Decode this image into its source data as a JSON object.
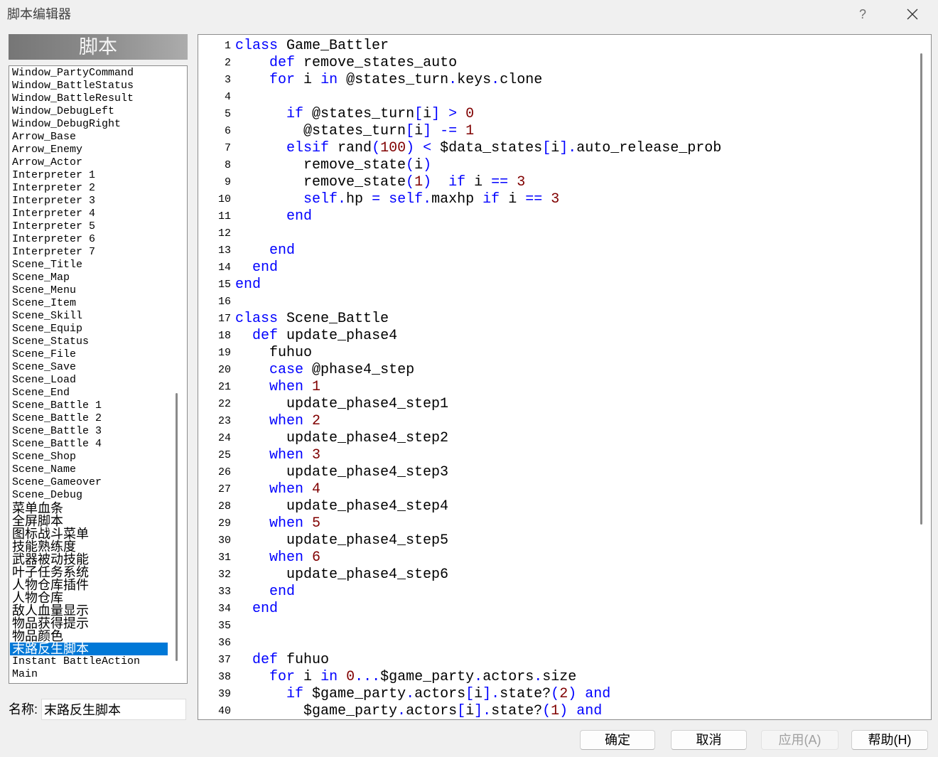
{
  "window": {
    "title": "脚本编辑器",
    "help_glyph": "?",
    "close_icon": "close-icon"
  },
  "sidebar": {
    "header": "脚本",
    "scripts": [
      "Window_PartyCommand",
      "Window_BattleStatus",
      "Window_BattleResult",
      "Window_DebugLeft",
      "Window_DebugRight",
      "Arrow_Base",
      "Arrow_Enemy",
      "Arrow_Actor",
      "Interpreter 1",
      "Interpreter 2",
      "Interpreter 3",
      "Interpreter 4",
      "Interpreter 5",
      "Interpreter 6",
      "Interpreter 7",
      "Scene_Title",
      "Scene_Map",
      "Scene_Menu",
      "Scene_Item",
      "Scene_Skill",
      "Scene_Equip",
      "Scene_Status",
      "Scene_File",
      "Scene_Save",
      "Scene_Load",
      "Scene_End",
      "Scene_Battle 1",
      "Scene_Battle 2",
      "Scene_Battle 3",
      "Scene_Battle 4",
      "Scene_Shop",
      "Scene_Name",
      "Scene_Gameover",
      "Scene_Debug",
      "菜单血条",
      "全屏脚本",
      "图标战斗菜单",
      "技能熟练度",
      "武器被动技能",
      "叶子任务系统",
      "人物仓库插件",
      "人物仓库",
      "敌人血量显示",
      "物品获得提示",
      "物品颜色",
      "末路反生脚本",
      "Instant BattleAction",
      "Main"
    ],
    "selected_index": 45,
    "name_label": "名称:",
    "name_value": "末路反生脚本"
  },
  "editor": {
    "lines": [
      {
        "n": 1,
        "code": "class Game_Battler"
      },
      {
        "n": 2,
        "code": "    def remove_states_auto"
      },
      {
        "n": 3,
        "code": "    for i in @states_turn.keys.clone"
      },
      {
        "n": 4,
        "code": ""
      },
      {
        "n": 5,
        "code": "      if @states_turn[i] > 0"
      },
      {
        "n": 6,
        "code": "        @states_turn[i] -= 1"
      },
      {
        "n": 7,
        "code": "      elsif rand(100) < $data_states[i].auto_release_prob"
      },
      {
        "n": 8,
        "code": "        remove_state(i)"
      },
      {
        "n": 9,
        "code": "        remove_state(1)  if i == 3"
      },
      {
        "n": 10,
        "code": "        self.hp = self.maxhp if i == 3"
      },
      {
        "n": 11,
        "code": "      end"
      },
      {
        "n": 12,
        "code": ""
      },
      {
        "n": 13,
        "code": "    end"
      },
      {
        "n": 14,
        "code": "  end"
      },
      {
        "n": 15,
        "code": "end"
      },
      {
        "n": 16,
        "code": ""
      },
      {
        "n": 17,
        "code": "class Scene_Battle"
      },
      {
        "n": 18,
        "code": "  def update_phase4"
      },
      {
        "n": 19,
        "code": "    fuhuo"
      },
      {
        "n": 20,
        "code": "    case @phase4_step"
      },
      {
        "n": 21,
        "code": "    when 1"
      },
      {
        "n": 22,
        "code": "      update_phase4_step1"
      },
      {
        "n": 23,
        "code": "    when 2"
      },
      {
        "n": 24,
        "code": "      update_phase4_step2"
      },
      {
        "n": 25,
        "code": "    when 3"
      },
      {
        "n": 26,
        "code": "      update_phase4_step3"
      },
      {
        "n": 27,
        "code": "    when 4"
      },
      {
        "n": 28,
        "code": "      update_phase4_step4"
      },
      {
        "n": 29,
        "code": "    when 5"
      },
      {
        "n": 30,
        "code": "      update_phase4_step5"
      },
      {
        "n": 31,
        "code": "    when 6"
      },
      {
        "n": 32,
        "code": "      update_phase4_step6"
      },
      {
        "n": 33,
        "code": "    end"
      },
      {
        "n": 34,
        "code": "  end"
      },
      {
        "n": 35,
        "code": ""
      },
      {
        "n": 36,
        "code": ""
      },
      {
        "n": 37,
        "code": "  def fuhuo"
      },
      {
        "n": 38,
        "code": "    for i in 0...$game_party.actors.size"
      },
      {
        "n": 39,
        "code": "      if $game_party.actors[i].state?(2) and"
      },
      {
        "n": 40,
        "code": "        $game_party.actors[i].state?(1) and"
      }
    ]
  },
  "buttons": {
    "ok": "确定",
    "cancel": "取消",
    "apply": "应用(A)",
    "apply_enabled": false,
    "help": "帮助(H)"
  },
  "colors": {
    "selection": "#0078d7",
    "keyword": "#0000ff",
    "number": "#800000",
    "operator": "#0000ff"
  }
}
